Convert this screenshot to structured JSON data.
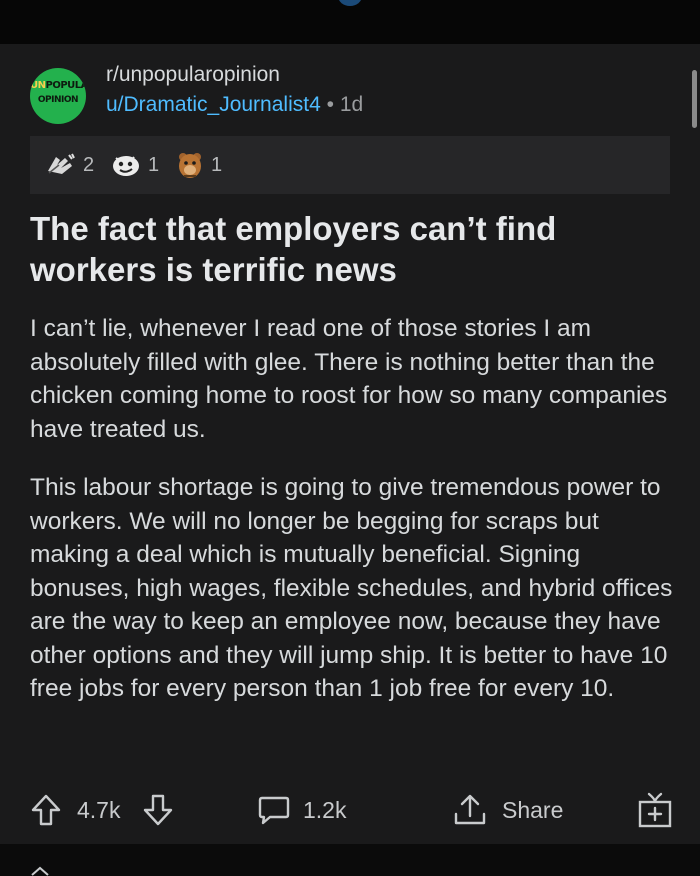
{
  "post": {
    "subreddit": "r/unpopularopinion",
    "author": "u/Dramatic_Journalist4",
    "separator": "•",
    "age": "1d",
    "avatar": {
      "line1_prefix": "UN",
      "line1_rest": "POPULAR",
      "line2": "OPINION",
      "color": "#23b14d"
    },
    "awards": [
      {
        "icon": "hands-award-icon",
        "count": "2"
      },
      {
        "icon": "face-award-icon",
        "count": "1"
      },
      {
        "icon": "bear-award-icon",
        "count": "1"
      }
    ],
    "title": "The fact that employers can’t find workers is terrific news",
    "paragraphs": [
      "I can’t lie, whenever I read one of those stories I am absolutely filled with glee. There is nothing better than the chicken coming home to roost for how so many companies have treated us.",
      "This labour shortage is going to give tremendous power to workers. We will no longer be begging for scraps but making a deal which is mutually beneficial. Signing bonuses, high wages, flexible schedules, and hybrid offices are the way to keep an employee now, because they have other options and they will jump ship. It is better to have 10 free jobs for every person than 1 job free for every 10."
    ]
  },
  "actions": {
    "upvotes": "4.7k",
    "comments": "1.2k",
    "share": "Share"
  },
  "colors": {
    "background": "#0b0b0b",
    "card": "#1a1a1b",
    "link": "#4fbcff",
    "text": "#d7dadc"
  }
}
